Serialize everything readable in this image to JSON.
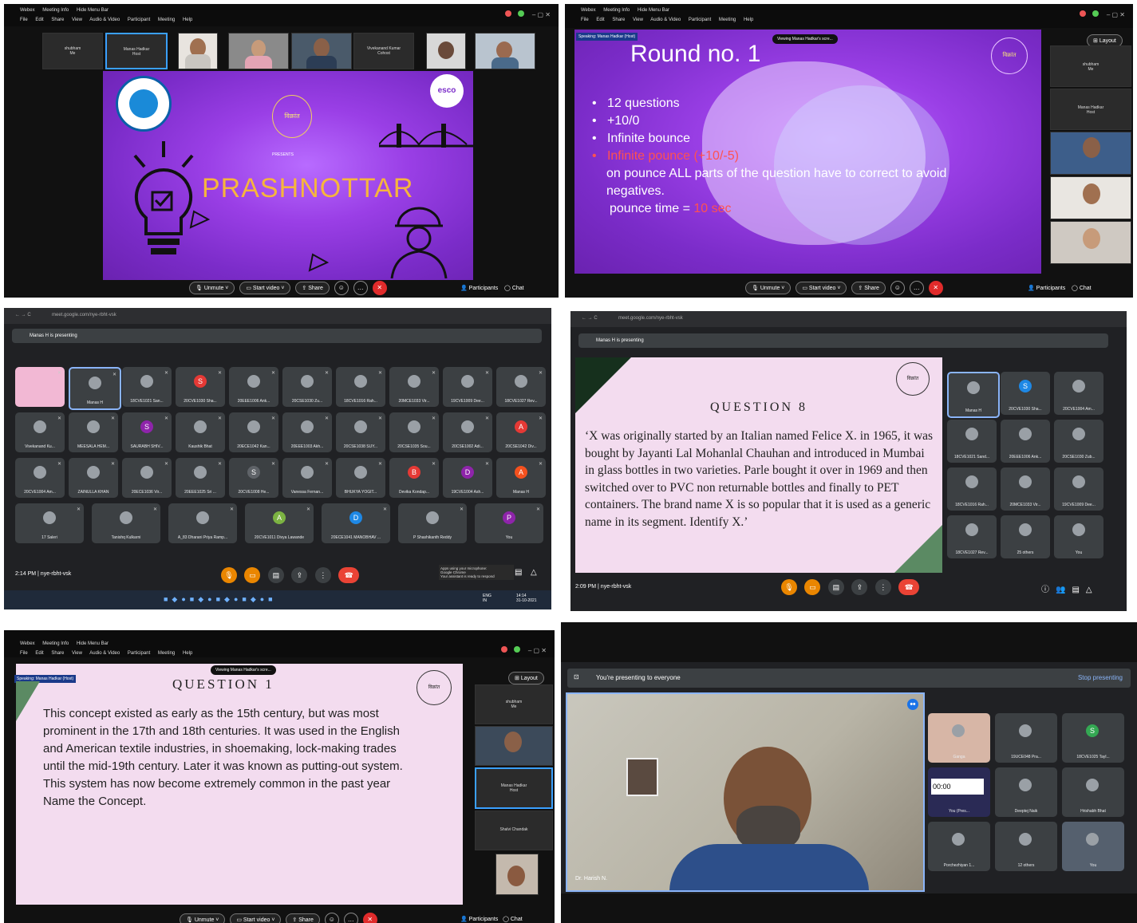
{
  "webex_menu": {
    "items": [
      "Webex",
      "Meeting Info",
      "Hide Menu Bar"
    ],
    "menus": [
      "File",
      "Edit",
      "Share",
      "View",
      "Audio & Video",
      "Participant",
      "Meeting",
      "Help"
    ],
    "layout_label": "Layout"
  },
  "panel1": {
    "participants": [
      {
        "name": "shubham",
        "sub": "Me"
      },
      {
        "name": "Manas Hadkar",
        "sub": "Host"
      },
      {
        "name": ""
      },
      {
        "name": ""
      },
      {
        "name": ""
      },
      {
        "name": "Vivekanand Kumar",
        "sub": "Cohost"
      },
      {
        "name": ""
      },
      {
        "name": ""
      }
    ],
    "slide": {
      "presents": "PRESENTS",
      "title": "PRASHNOTTAR",
      "logo_right": "esco",
      "logo_mid": "विक्रांत"
    },
    "toolbar": {
      "unmute": "Unmute",
      "start_video": "Start video",
      "share": "Share",
      "participants": "Participants",
      "chat": "Chat"
    }
  },
  "panel2": {
    "speaking": "Speaking: Manas Hadkar (Host)",
    "viewing": "Viewing Manas Hadkar's scre...",
    "slide": {
      "title": "Round no. 1",
      "bullets": [
        "12 questions",
        "+10/0",
        "Infinite bounce"
      ],
      "pounce_red": "Infinite pounce",
      "pounce_score": "(+10/-5)",
      "line1": "on pounce ALL parts of the question have to correct to avoid",
      "line2": "negatives.",
      "time_label": "pounce time =",
      "time_value": "10 sec"
    },
    "side": [
      {
        "name": "shubham",
        "sub": "Me"
      },
      {
        "name": "Manas Hadkar",
        "sub": "Host"
      }
    ],
    "toolbar": {
      "unmute": "Unmute",
      "start_video": "Start video",
      "share": "Share",
      "participants": "Participants",
      "chat": "Chat"
    }
  },
  "panel3": {
    "url": "meet.google.com/nye-rbht-vsk",
    "presenting": "Manas H is presenting",
    "tiles": [
      [
        "",
        "Manas H",
        "18CVE1021 San...",
        "20CVE1030 Sha...",
        "20EEE1006 Ank...",
        "20CSE1030 Zu...",
        "18CVE1016 Rah...",
        "20MCE1033 Vir...",
        "19CVE1009 Dee...",
        "18CVE1027 Rev..."
      ],
      [
        "Vivekanand Ku...",
        "MEESALA HEM...",
        "SAURABH SHIV...",
        "Kaushik Bhat",
        "20ECE1042 Kan...",
        "20EEE1003 Akh...",
        "20CSE1038 SUY...",
        "20CSE1035 Sou...",
        "20CSE1002 Adi...",
        "20CSE1042 Div..."
      ],
      [
        "20CVE1004 Am...",
        "ZAINULLA KHAN",
        "20ECE1036 Vir...",
        "20EEE1025 Sri ...",
        "20CVE1008 He...",
        "Vanessa Fernan...",
        "BHUKYA YOGIT...",
        "Devika Kondap...",
        "19CVE1004 Ash...",
        "Manas H"
      ],
      [
        "17 Saleri",
        "Tanishq Kulkarni",
        "A_83 Dharani Priya Ramp...",
        "20CVE1011 Divya Lawande",
        "20ECE1041 MANOBHAV ...",
        "P Shashikanth Reddy",
        "You"
      ]
    ],
    "letters": {
      "3": "S",
      "12": "S",
      "19": "A",
      "24": "S",
      "27": "B",
      "28": "D",
      "29": "A",
      "33": "A",
      "34": "D",
      "36": "P"
    },
    "meeting_time": "2:14 PM",
    "meeting_code": "nye-rbht-vsk",
    "mic_notice": [
      "Apps using your microphone:",
      "Google Chrome",
      "Your assistant is ready to respond"
    ],
    "taskbar": {
      "lang": "ENG",
      "region": "IN",
      "time": "14:14",
      "date": "31-10-2021"
    }
  },
  "panel4": {
    "url": "meet.google.com/nye-rbht-vsk",
    "presenting": "Manas H is presenting",
    "slide": {
      "heading": "QUESTION 8",
      "body": "‘X was originally started by an Italian named Felice X. in 1965, it was bought by Jayanti Lal Mohanlal Chauhan and introduced in Mumbai in glass bottles in two varieties. Parle bought it over in 1969 and then switched over to PVC non returnable bottles and finally to PET containers. The brand name X is so popular that it is used as a generic name in its segment. Identify X.’"
    },
    "tiles": [
      "Manas H",
      "20CVE1030 Sha...",
      "20CVE1004 Am...",
      "18CVE1021 Sand...",
      "20EEE1006 Ank...",
      "20CSE1030 Zub...",
      "18CVE1016 Rah...",
      "20MCE1033 Vir...",
      "19CVE1009 Dee...",
      "18CVE1027 Rev...",
      "25 others",
      "You"
    ],
    "meeting_time": "2:09 PM",
    "meeting_code": "nye-rbht-vsk"
  },
  "panel5": {
    "speaking": "Speaking: Manas Hadkar (Host)",
    "viewing": "Viewing Manas Hadkar's scre...",
    "slide": {
      "heading": "QUESTION 1",
      "lines": [
        "This concept existed as early as the 15th century, but was most",
        "prominent in the 17th and 18th centuries. It was used in the English",
        "and American textile industries, in shoemaking, lock-making trades",
        "until the mid-19th century. Later it was known as putting-out system.",
        "This system has now  become extremely common in the past year",
        "Name the Concept."
      ]
    },
    "side": [
      {
        "name": "shubham",
        "sub": "Me"
      },
      {
        "name": "Manas Hadkar",
        "sub": "Host"
      },
      {
        "name": "Shalvi Chandak",
        "sub": ""
      }
    ],
    "toolbar": {
      "unmute": "Unmute",
      "start_video": "Start video",
      "share": "Share",
      "participants": "Participants",
      "chat": "Chat"
    }
  },
  "panel6": {
    "banner": "You're presenting to everyone",
    "stop": "Stop presenting",
    "main_name": "Dr. Harish N.",
    "timer": "00:00",
    "tiles": [
      {
        "name": "Ganga",
        "letter": ""
      },
      {
        "name": "19UCE048 Pra...",
        "letter": ""
      },
      {
        "name": "18CVE1025 Tayl...",
        "letter": "S"
      },
      {
        "name": "You (Pres...",
        "letter": ""
      },
      {
        "name": "Deeptej Naik",
        "letter": ""
      },
      {
        "name": "Hrishabh Bhat",
        "letter": ""
      },
      {
        "name": "Porchezhiyan 1...",
        "letter": ""
      },
      {
        "name": "12 others",
        "letter": ""
      },
      {
        "name": "You",
        "letter": ""
      }
    ]
  },
  "colors": {
    "webex_purple": "#8e3de0",
    "meet_bg": "#202124",
    "tile_bg": "#3c4043",
    "end_red": "#e02b2b",
    "slide_pink": "#f3dcef",
    "accent_orange": "#f6b53d"
  }
}
